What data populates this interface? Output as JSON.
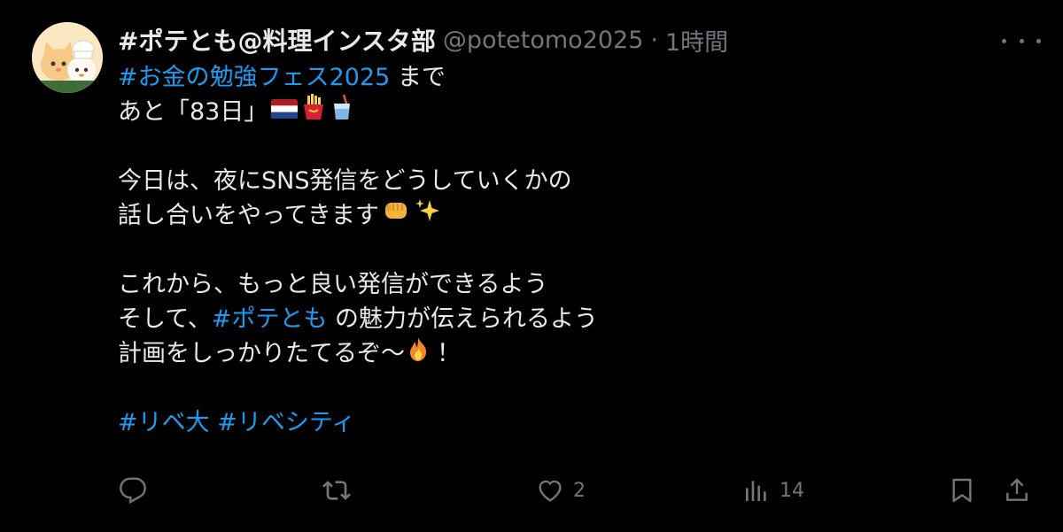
{
  "user": {
    "display_name": "#ポテとも@料理インスタ部",
    "handle": "@potetomo2025",
    "separator": "·",
    "time": "1時間"
  },
  "tweet": {
    "line1_tag": "#お金の勉強フェス2025",
    "line1_text": " まで",
    "line2_text": "あと「83日」",
    "line2_emojis": [
      "flag-netherlands-icon",
      "french-fries-icon",
      "cup-with-straw-icon"
    ],
    "line3_text": "今日は、夜にSNS発信をどうしていくかの",
    "line4_text": "話し合いをやってきます",
    "line4_emojis": [
      "fist-icon",
      "sparkles-icon"
    ],
    "line5_text": "これから、もっと良い発信ができるよう",
    "line6_prefix": "そして、",
    "line6_tag": "#ポテとも",
    "line6_suffix": " の魅力が伝えられるよう",
    "line7_text": "計画をしっかりたてるぞ〜",
    "line7_emoji": "fire-icon",
    "line7_suffix": "！",
    "hashtag1": "#リベ大",
    "hashtag2": "#リベシティ"
  },
  "actions": {
    "reply_count": "",
    "retweet_count": "",
    "like_count": "2",
    "views_count": "14"
  },
  "colors": {
    "background": "#000000",
    "text": "#e7e9ea",
    "muted": "#71767b",
    "link": "#1d9bf0"
  }
}
